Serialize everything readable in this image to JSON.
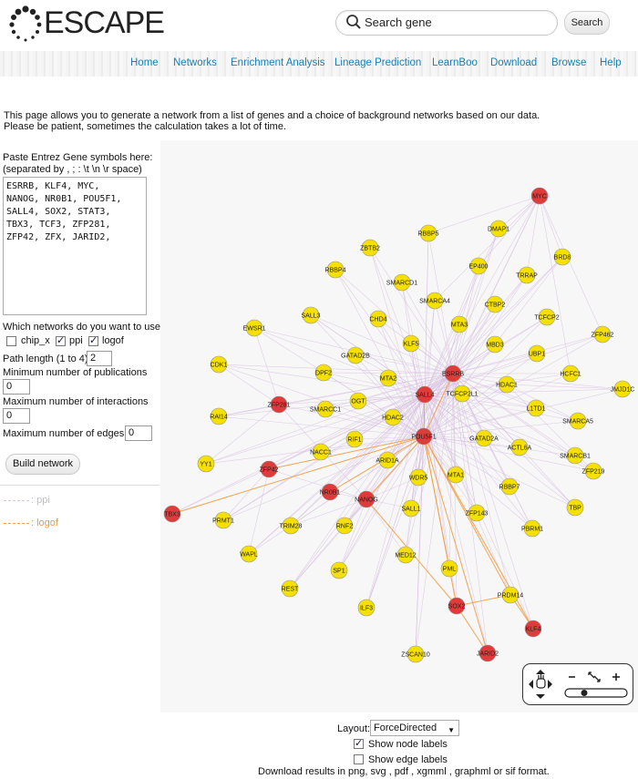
{
  "header": {
    "logo_text": "ESCAPE",
    "search_placeholder": "Search gene",
    "search_button": "Search"
  },
  "nav": [
    "Home",
    "Networks",
    "Enrichment Analysis",
    "Lineage Prediction",
    "LearnBoo",
    "Download",
    "Browse",
    "Help"
  ],
  "intro": {
    "line1": "This page allows you to generate a network from a list of genes and a choice of background networks based on our data.",
    "line2": "Please be patient, sometimes the calculation takes a lot of time."
  },
  "form": {
    "paste_label": "Paste Entrez Gene symbols here:",
    "separator_label": "(separated by , ; : \\t \\n \\r space)",
    "genes_value": "ESRRB, KLF4, MYC,\nNANOG, NR0B1, POU5F1,\nSALL4, SOX2, STAT3,\nTBX3, TCF3, ZFP281,\nZFP42, ZFX, JARID2,",
    "networks_label": "Which networks do you want to use?",
    "networks": [
      {
        "label": "chip_x",
        "checked": false
      },
      {
        "label": "ppi",
        "checked": true
      },
      {
        "label": "logof",
        "checked": true
      }
    ],
    "path_length_label": "Path length (1 to 4)",
    "path_length_value": "2",
    "min_pub_label": "Minimum number of publications",
    "min_pub_value": "0",
    "max_inter_label": "Maximum number of interactions",
    "max_inter_value": "0",
    "max_edges_label": "Maximum number of edges",
    "max_edges_value": "0",
    "build_button": "Build network"
  },
  "legend": [
    {
      "label": ": ppi",
      "color": "#d9c9e0"
    },
    {
      "label": ": logof",
      "color": "#f0a050"
    }
  ],
  "network": {
    "node_colors": {
      "query": "#e03b3b",
      "other": "#f5e000"
    },
    "edge_colors": {
      "ppi": "#d7bfe0",
      "logof": "#f2a24a"
    },
    "nodes": [
      {
        "id": "MYC",
        "type": "query"
      },
      {
        "id": "DMAP1",
        "type": "other"
      },
      {
        "id": "RBBP5",
        "type": "other"
      },
      {
        "id": "ZBTB2",
        "type": "other"
      },
      {
        "id": "BRD8",
        "type": "other"
      },
      {
        "id": "EP400",
        "type": "other"
      },
      {
        "id": "TRRAP",
        "type": "other"
      },
      {
        "id": "RBBP4",
        "type": "other"
      },
      {
        "id": "SMARCD1",
        "type": "other"
      },
      {
        "id": "SMARCA4",
        "type": "other"
      },
      {
        "id": "CTBP2",
        "type": "other"
      },
      {
        "id": "SALL3",
        "type": "other"
      },
      {
        "id": "CHD4",
        "type": "other"
      },
      {
        "id": "MTA3",
        "type": "other"
      },
      {
        "id": "TCFCP2",
        "type": "other"
      },
      {
        "id": "EWSR1",
        "type": "other"
      },
      {
        "id": "ZFP462",
        "type": "other"
      },
      {
        "id": "KLF5",
        "type": "other"
      },
      {
        "id": "MBD3",
        "type": "other"
      },
      {
        "id": "UBP1",
        "type": "other"
      },
      {
        "id": "GATAD2B",
        "type": "other"
      },
      {
        "id": "CDK1",
        "type": "other"
      },
      {
        "id": "DPF2",
        "type": "other"
      },
      {
        "id": "MTA2",
        "type": "other"
      },
      {
        "id": "ESRRB",
        "type": "query"
      },
      {
        "id": "HCFC1",
        "type": "other"
      },
      {
        "id": "JMJD1C",
        "type": "other"
      },
      {
        "id": "ZFP281",
        "type": "query"
      },
      {
        "id": "OGT",
        "type": "other"
      },
      {
        "id": "SALL4",
        "type": "query"
      },
      {
        "id": "TCFCP2L1",
        "type": "other"
      },
      {
        "id": "HDAC1",
        "type": "other"
      },
      {
        "id": "L1TD1",
        "type": "other"
      },
      {
        "id": "SMARCC1",
        "type": "other"
      },
      {
        "id": "HDAC2",
        "type": "other"
      },
      {
        "id": "RAI14",
        "type": "other"
      },
      {
        "id": "SMARCA5",
        "type": "other"
      },
      {
        "id": "RIF1",
        "type": "other"
      },
      {
        "id": "POU5F1",
        "type": "query"
      },
      {
        "id": "GATAD2A",
        "type": "other"
      },
      {
        "id": "ACTL6A",
        "type": "other"
      },
      {
        "id": "SMARCB1",
        "type": "other"
      },
      {
        "id": "NACC1",
        "type": "other"
      },
      {
        "id": "ARID1A",
        "type": "other"
      },
      {
        "id": "YY1",
        "type": "other"
      },
      {
        "id": "ZFP42",
        "type": "query"
      },
      {
        "id": "ZFP219",
        "type": "other"
      },
      {
        "id": "MTA1",
        "type": "other"
      },
      {
        "id": "WDR5",
        "type": "other"
      },
      {
        "id": "RBBP7",
        "type": "other"
      },
      {
        "id": "NR0B1",
        "type": "query"
      },
      {
        "id": "NANOG",
        "type": "query"
      },
      {
        "id": "TBX3",
        "type": "query"
      },
      {
        "id": "SALL1",
        "type": "other"
      },
      {
        "id": "TBP",
        "type": "other"
      },
      {
        "id": "ZFP143",
        "type": "other"
      },
      {
        "id": "PBRM1",
        "type": "other"
      },
      {
        "id": "PRMT1",
        "type": "other"
      },
      {
        "id": "TRIM28",
        "type": "other"
      },
      {
        "id": "RNF2",
        "type": "other"
      },
      {
        "id": "WAPL",
        "type": "other"
      },
      {
        "id": "MED12",
        "type": "other"
      },
      {
        "id": "SP1",
        "type": "other"
      },
      {
        "id": "PML",
        "type": "other"
      },
      {
        "id": "REST",
        "type": "other"
      },
      {
        "id": "PRDM14",
        "type": "other"
      },
      {
        "id": "SOX2",
        "type": "query"
      },
      {
        "id": "ILF3",
        "type": "other"
      },
      {
        "id": "KLF4",
        "type": "query"
      },
      {
        "id": "ZSCAN10",
        "type": "other"
      },
      {
        "id": "JARID2",
        "type": "query"
      }
    ],
    "logof_edges": [
      [
        "TBX3",
        "POU5F1"
      ],
      [
        "ZFP42",
        "POU5F1"
      ],
      [
        "NANOG",
        "POU5F1"
      ],
      [
        "NR0B1",
        "POU5F1"
      ],
      [
        "POU5F1",
        "SOX2"
      ],
      [
        "POU5F1",
        "KLF4"
      ],
      [
        "POU5F1",
        "JARID2"
      ],
      [
        "POU5F1",
        "PRDM14"
      ],
      [
        "POU5F1",
        "PML"
      ],
      [
        "SOX2",
        "PRDM14"
      ],
      [
        "NANOG",
        "SOX2"
      ],
      [
        "SOX2",
        "JARID2"
      ],
      [
        "PRDM14",
        "KLF4"
      ],
      [
        "ESRRB",
        "POU5F1"
      ],
      [
        "SALL4",
        "POU5F1"
      ]
    ]
  },
  "layout_control": {
    "label": "Layout:",
    "selected": "ForceDirected",
    "show_node_labels": "Show node labels",
    "show_node_labels_checked": true,
    "show_edge_labels": "Show edge labels",
    "show_edge_labels_checked": false
  },
  "footer": {
    "download_text": "Download results in png, svg , pdf , xgmml , graphml or sif format."
  }
}
